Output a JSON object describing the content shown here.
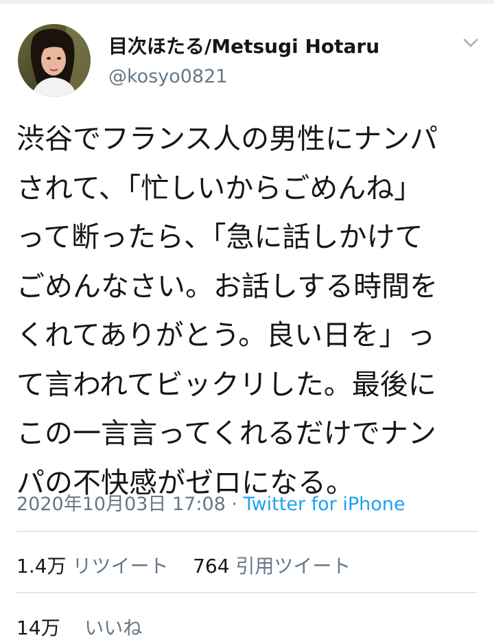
{
  "user": {
    "display_name": "目次ほたる/Metsugi Hotaru",
    "handle": "@kosyo0821",
    "avatar_icon": "profile-photo"
  },
  "menu": {
    "icon": "chevron-down-icon"
  },
  "tweet": {
    "text_lines": [
      "渋谷でフランス人の男性にナンパ",
      "されて、「忙しいからごめんね」",
      "って断ったら、「急に話しかけて",
      "ごめんなさい。お話しする時間を",
      "くれてありがとう。良い日を」っ",
      "て言われてビックリした。最後に",
      "この一言言ってくれるだけでナン",
      "パの不快感がゼロになる。"
    ],
    "timestamp": "2020年10月03日 17:08",
    "separator": " · ",
    "source": "Twitter for iPhone"
  },
  "stats": {
    "retweets_count": "1.4万",
    "retweets_label": "リツイート",
    "quotes_count": "764",
    "quotes_label": "引用ツイート",
    "likes_count": "14万",
    "likes_label": "いいね"
  },
  "colors": {
    "text": "#14171a",
    "secondary": "#657786",
    "link": "#1da1f2",
    "divider": "#e1e8ed"
  }
}
